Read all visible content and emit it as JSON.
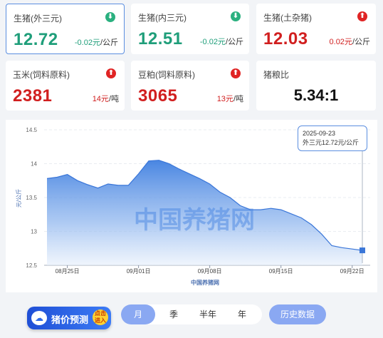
{
  "cards": [
    {
      "name": "生猪(外三元)",
      "price": "12.72",
      "change": "-0.02元",
      "unit": "/公斤",
      "trend": "down"
    },
    {
      "name": "生猪(内三元)",
      "price": "12.51",
      "change": "-0.02元",
      "unit": "/公斤",
      "trend": "down"
    },
    {
      "name": "生猪(土杂猪)",
      "price": "12.03",
      "change": "0.02元",
      "unit": "/公斤",
      "trend": "up"
    },
    {
      "name": "玉米(饲料原料)",
      "price": "2381",
      "change": "14元",
      "unit": "/吨",
      "trend": "up"
    },
    {
      "name": "豆粕(饲料原料)",
      "price": "3065",
      "change": "13元",
      "unit": "/吨",
      "trend": "up"
    },
    {
      "name": "猪粮比",
      "price": "5.34:1"
    }
  ],
  "icons": {
    "down": "arrow-down-icon",
    "up": "arrow-up-icon"
  },
  "colors": {
    "green": "#1f9e7a",
    "red": "#d11f1f",
    "accent": "#5b8ee0"
  },
  "tooltip": {
    "date": "2025-09-23",
    "text": "外三元12.72元/公斤"
  },
  "watermark": "中国养猪网",
  "chart_data": {
    "type": "area",
    "ylabel": "元/公斤",
    "xlabel": "中国养猪网",
    "ylim": [
      12.5,
      14.5
    ],
    "yticks": [
      "14.5",
      "14",
      "13.5",
      "13",
      "12.5"
    ],
    "xticks": [
      "08月25日",
      "09月01日",
      "09月08日",
      "09月15日",
      "09月22日"
    ],
    "x": [
      "08-23",
      "08-24",
      "08-25",
      "08-26",
      "08-27",
      "08-28",
      "08-29",
      "08-30",
      "08-31",
      "09-01",
      "09-02",
      "09-03",
      "09-04",
      "09-05",
      "09-06",
      "09-07",
      "09-08",
      "09-09",
      "09-10",
      "09-11",
      "09-12",
      "09-13",
      "09-14",
      "09-15",
      "09-16",
      "09-17",
      "09-18",
      "09-19",
      "09-20",
      "09-21",
      "09-22",
      "09-23"
    ],
    "series": [
      {
        "values": [
          13.78,
          13.8,
          13.84,
          13.75,
          13.69,
          13.64,
          13.7,
          13.68,
          13.68,
          13.85,
          14.04,
          14.05,
          14.0,
          13.92,
          13.85,
          13.78,
          13.7,
          13.58,
          13.5,
          13.38,
          13.32,
          13.32,
          13.34,
          13.32,
          13.26,
          13.2,
          13.1,
          12.96,
          12.79,
          12.76,
          12.74,
          12.72
        ]
      }
    ]
  },
  "bottom": {
    "logo_text": "猪价预测",
    "logo_bubble": "点击进入",
    "periods": [
      "月",
      "季",
      "半年",
      "年"
    ],
    "selected": "月",
    "history_button": "历史数据"
  }
}
